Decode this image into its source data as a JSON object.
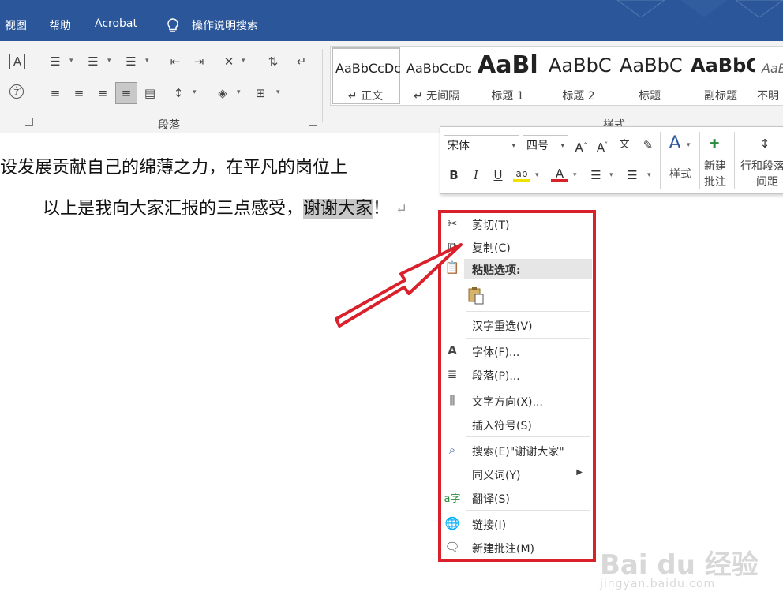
{
  "menubar": {
    "items": [
      "视图",
      "帮助",
      "Acrobat",
      "操作说明搜索"
    ]
  },
  "ribbon": {
    "paragraph_group_label": "段落",
    "styles_group_label": "样式",
    "styles": [
      {
        "preview": "AaBbCcDc",
        "name": "↵ 正文"
      },
      {
        "preview": "AaBbCcDc",
        "name": "↵ 无间隔"
      },
      {
        "preview": "AaBl",
        "name": "标题 1"
      },
      {
        "preview": "AaBbC",
        "name": "标题 2"
      },
      {
        "preview": "AaBbC",
        "name": "标题"
      },
      {
        "preview": "AaBbC",
        "name": "副标题"
      },
      {
        "preview": "AaBb",
        "name": "不明"
      }
    ]
  },
  "document": {
    "line1": "设发展贡献自己的绵薄之力，在平凡的岗位上",
    "line2_plain": "以上是我向大家汇报的三点感受，",
    "line2_selected": "谢谢大家",
    "line2_end": "！",
    "pilcrow": "↵"
  },
  "mini_toolbar": {
    "font": "宋体",
    "size": "四号",
    "styles_label": "样式",
    "new_comment_label": [
      "新建",
      "批注"
    ],
    "line_spacing_label": [
      "行和段落",
      "间距"
    ]
  },
  "context_menu": {
    "items": [
      {
        "label": "剪切(T)",
        "icon": "scissors-icon"
      },
      {
        "label": "复制(C)",
        "icon": "copy-icon"
      },
      {
        "label": "粘贴选项:",
        "icon": "paste-icon"
      },
      {
        "label": "汉字重选(V)",
        "icon": ""
      },
      {
        "label": "字体(F)...",
        "icon": "font-icon"
      },
      {
        "label": "段落(P)...",
        "icon": "paragraph-icon"
      },
      {
        "label": "文字方向(X)...",
        "icon": "text-direction-icon"
      },
      {
        "label": "插入符号(S)",
        "icon": ""
      },
      {
        "label": "搜索(E)\"谢谢大家\"",
        "icon": "search-icon"
      },
      {
        "label": "同义词(Y)",
        "icon": ""
      },
      {
        "label": "翻译(S)",
        "icon": "translate-icon"
      },
      {
        "label": "链接(I)",
        "icon": "link-icon"
      },
      {
        "label": "新建批注(M)",
        "icon": "comment-icon"
      }
    ]
  },
  "colors": {
    "menubar": "#2b579a",
    "highlight_frame": "#d9202b",
    "arrow": "#d9202b",
    "selection": "#c8c8c8"
  },
  "watermark": {
    "brand": "Bai du 经验",
    "url": "jingyan.baidu.com"
  }
}
